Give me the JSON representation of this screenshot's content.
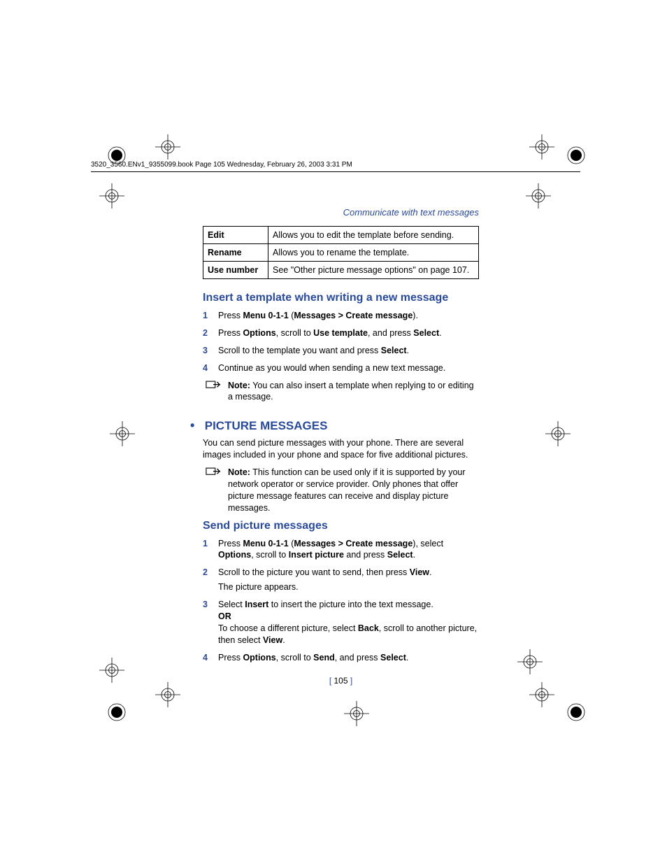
{
  "header": "3520_3560.ENv1_9355099.book  Page 105  Wednesday, February 26, 2003  3:31 PM",
  "running_head": "Communicate with text messages",
  "table": {
    "rows": [
      {
        "c1": "Edit",
        "c2": "Allows you to edit the template before sending."
      },
      {
        "c1": "Rename",
        "c2": "Allows you to rename the template."
      },
      {
        "c1": "Use number",
        "c2": "See \"Other picture message options\" on page 107."
      }
    ]
  },
  "sec1": {
    "title": "Insert a template when writing a new message",
    "step1_a": "Press ",
    "step1_b": "Menu 0-1-1",
    "step1_c": " (",
    "step1_d": "Messages > Create message",
    "step1_e": ").",
    "step2_a": "Press ",
    "step2_b": "Options",
    "step2_c": ", scroll to ",
    "step2_d": "Use template",
    "step2_e": ", and press ",
    "step2_f": "Select",
    "step2_g": ".",
    "step3_a": "Scroll to the template you want and press ",
    "step3_b": "Select",
    "step3_c": ".",
    "step4": "Continue as you would when sending a new text message.",
    "note_b": "Note:",
    "note_t": " You can also insert a template when replying to or editing a message."
  },
  "sec2": {
    "bullet": "•",
    "title": "PICTURE MESSAGES",
    "intro": "You can send picture messages with your phone. There are several images included in your phone and space for five additional pictures.",
    "note_b": "Note:",
    "note_t": " This function can be used only if it is supported by your network operator or service provider. Only phones that offer picture message features can receive and display picture messages."
  },
  "sec3": {
    "title": "Send picture messages",
    "step1_a": "Press ",
    "step1_b": "Menu 0-1-1",
    "step1_c": " (",
    "step1_d": "Messages > Create message",
    "step1_e": "), select ",
    "step1_f": "Options",
    "step1_g": ", scroll to ",
    "step1_h": "Insert picture",
    "step1_i": " and press ",
    "step1_j": "Select",
    "step1_k": ".",
    "step2_a": "Scroll to the picture you want to send, then press ",
    "step2_b": "View",
    "step2_c": ".",
    "step2_sub": "The picture appears.",
    "step3_a": "Select ",
    "step3_b": "Insert",
    "step3_c": " to insert the picture into the text message.",
    "step3_or": "OR",
    "step3_d": "To choose a different picture, select ",
    "step3_e": "Back",
    "step3_f": ", scroll to another picture, then select ",
    "step3_g": "View",
    "step3_h": ".",
    "step4_a": "Press ",
    "step4_b": "Options",
    "step4_c": ", scroll to ",
    "step4_d": "Send",
    "step4_e": ", and press ",
    "step4_f": "Select",
    "step4_g": "."
  },
  "page_num": {
    "lb": "[ ",
    "n": "105",
    "rb": " ]"
  }
}
